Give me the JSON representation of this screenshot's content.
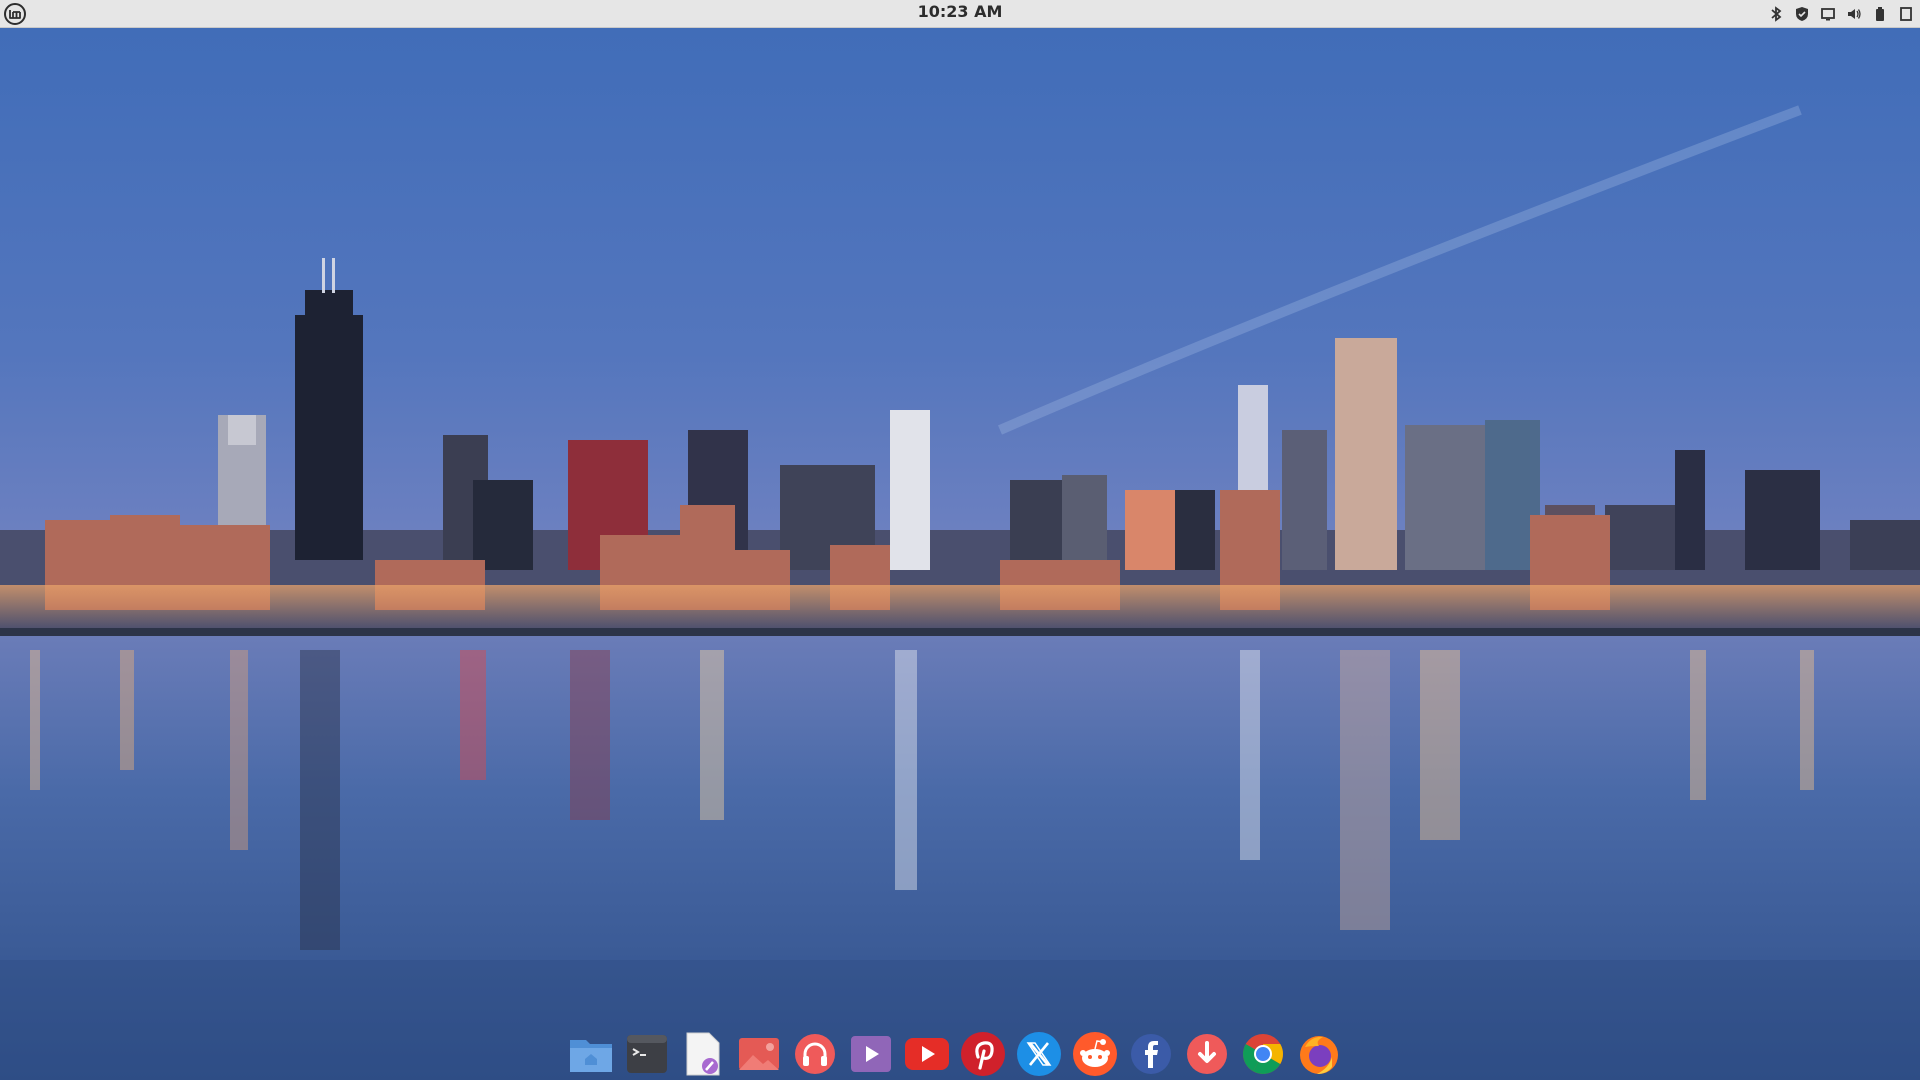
{
  "top_panel": {
    "clock": "10:23 AM",
    "menu_icon": "linux-mint-menu-icon",
    "tray_icons": [
      "bluetooth-icon",
      "shield-icon",
      "display-icon",
      "volume-icon",
      "battery-icon",
      "show-desktop-icon"
    ]
  },
  "dock": {
    "apps": [
      {
        "name": "files-icon"
      },
      {
        "name": "terminal-icon"
      },
      {
        "name": "text-editor-icon"
      },
      {
        "name": "photo-viewer-icon"
      },
      {
        "name": "music-player-icon"
      },
      {
        "name": "video-player-icon"
      },
      {
        "name": "youtube-icon"
      },
      {
        "name": "pinterest-icon"
      },
      {
        "name": "x-twitter-icon"
      },
      {
        "name": "reddit-icon"
      },
      {
        "name": "facebook-icon"
      },
      {
        "name": "download-manager-icon"
      },
      {
        "name": "chrome-icon"
      },
      {
        "name": "firefox-icon"
      }
    ]
  },
  "colors": {
    "panel": "#e6e6e6",
    "sky_top": "#3c68b4",
    "water": "#3a5f9c"
  }
}
